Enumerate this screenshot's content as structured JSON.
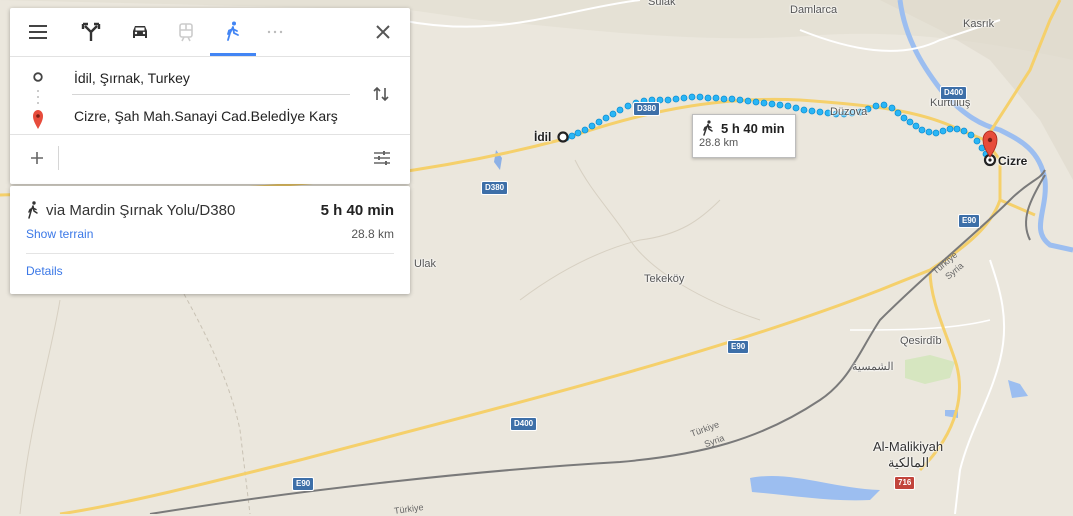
{
  "panel": {
    "modes": [
      {
        "name": "menu",
        "icon": "hamburger-menu-icon"
      },
      {
        "name": "best",
        "icon": "directions-icon"
      },
      {
        "name": "driving",
        "icon": "car-icon"
      },
      {
        "name": "transit",
        "icon": "train-icon",
        "disabled": true
      },
      {
        "name": "walking",
        "icon": "walk-icon",
        "active": true
      },
      {
        "name": "more",
        "icon": "more-icon"
      }
    ],
    "origin": "İdil, Şırnak, Turkey",
    "destination": "Cizre, Şah Mah.Sanayi Cad.Beledİye Karş",
    "accent_color": "#4285f4"
  },
  "route": {
    "via": "via Mardin Şırnak Yolu/D380",
    "duration": "5 h 40 min",
    "distance": "28.8 km",
    "terrain_link": "Show terrain",
    "details_link": "Details",
    "route_color": "#1da1f2"
  },
  "bubble": {
    "duration": "5 h 40 min",
    "distance": "28.8 km"
  },
  "map": {
    "places": {
      "sulak": "Sulak",
      "damlarca": "Damlarca",
      "kasrik": "Kasrık",
      "kurtulus": "Kurtuluş",
      "duzova": "Düzova",
      "idil": "İdil",
      "cizre": "Cizre",
      "ulak": "Ulak",
      "tekekoy": "Tekeköy",
      "qesirdib": "Qesirdîb",
      "shamsiya": "الشمسية",
      "malikiyah": "Al-Malikiyah",
      "malikiyah_ar": "المالكية",
      "turkiye1": "Türkiye",
      "syria1": "Syria",
      "turkiye2": "Türkiye",
      "syria2": "Syria",
      "turkiye3": "Türkiye"
    },
    "shields": {
      "d400_top": "D400",
      "d380_route": "D380",
      "d380_left": "D380",
      "e90_right": "E90",
      "e90_mid": "E90",
      "d400_mid": "D400",
      "e90_left": "E90",
      "r716": "716"
    }
  }
}
